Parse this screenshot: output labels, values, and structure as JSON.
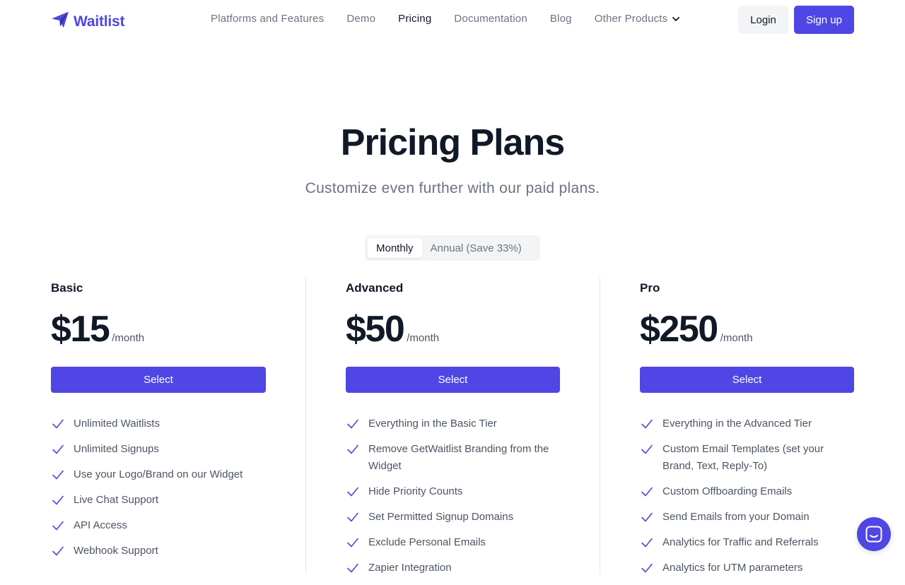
{
  "brand": {
    "name": "Waitlist",
    "color": "#4f46e5"
  },
  "nav": {
    "links": [
      "Platforms and Features",
      "Demo",
      "Pricing",
      "Documentation",
      "Blog",
      "Other Products"
    ],
    "active": "Pricing",
    "login_label": "Login",
    "signup_label": "Sign up"
  },
  "hero": {
    "title": "Pricing Plans",
    "subtitle": "Customize even further with our paid plans."
  },
  "billing_toggle": {
    "options": [
      "Monthly",
      "Annual (Save 33%)"
    ],
    "selected": "Monthly"
  },
  "plans": [
    {
      "name": "Basic",
      "price": "$15",
      "period": "/month",
      "cta": "Select",
      "features": [
        "Unlimited Waitlists",
        "Unlimited Signups",
        "Use your Logo/Brand on our Widget",
        "Live Chat Support",
        "API Access",
        "Webhook Support"
      ]
    },
    {
      "name": "Advanced",
      "price": "$50",
      "period": "/month",
      "cta": "Select",
      "features": [
        "Everything in the Basic Tier",
        "Remove GetWaitlist Branding from the Widget",
        "Hide Priority Counts",
        "Set Permitted Signup Domains",
        "Exclude Personal Emails",
        "Zapier Integration"
      ]
    },
    {
      "name": "Pro",
      "price": "$250",
      "period": "/month",
      "cta": "Select",
      "features": [
        "Everything in the Advanced Tier",
        "Custom Email Templates (set your Brand, Text, Reply-To)",
        "Custom Offboarding Emails",
        "Send Emails from your Domain",
        "Analytics for Traffic and Referrals",
        "Analytics for UTM parameters"
      ]
    }
  ],
  "icons": {
    "logo": "paper-plane-icon",
    "dropdown": "chevron-down-icon",
    "feature": "check-icon",
    "chat": "chat-icon"
  }
}
